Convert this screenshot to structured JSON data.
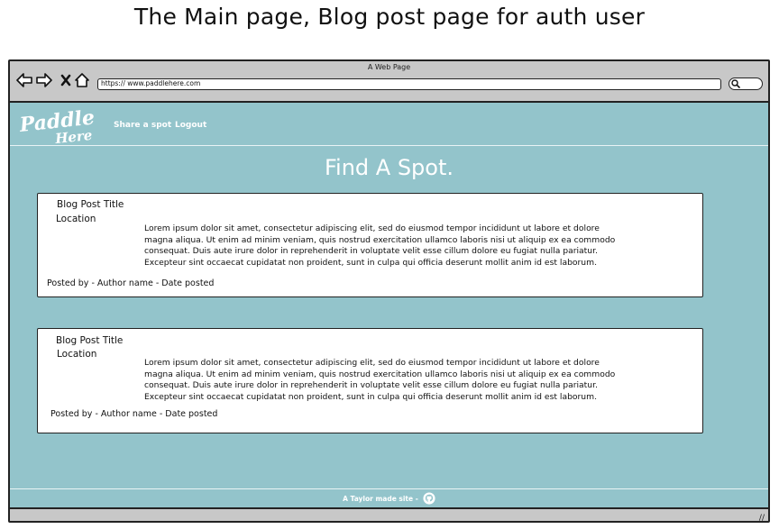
{
  "caption": "The Main page, Blog post page for auth user",
  "browser": {
    "window_title": "A Web Page",
    "url": "https:// www.paddlehere.com",
    "icons": [
      "back-arrow-icon",
      "forward-arrow-icon",
      "close-icon",
      "home-icon",
      "search-icon",
      "resize-grip-icon"
    ]
  },
  "site": {
    "logo_line1": "Paddle",
    "logo_line2": "Here",
    "nav": {
      "share": "Share a spot",
      "logout": "Logout"
    },
    "heading": "Find A Spot.",
    "footer_text": "A Taylor made site -",
    "footer_icon": "github-icon",
    "accent_color": "#93c4cb"
  },
  "posts": [
    {
      "title": "Blog Post Title",
      "location": "Location",
      "body": "Lorem ipsum dolor sit amet, consectetur adipiscing elit, sed do eiusmod tempor incididunt ut labore et dolore magna aliqua. Ut enim ad minim veniam, quis nostrud exercitation ullamco laboris nisi ut aliquip ex ea commodo consequat. Duis aute irure dolor in reprehenderit in voluptate velit esse cillum dolore eu fugiat nulla pariatur. Excepteur sint occaecat cupidatat non proident, sunt in culpa qui officia deserunt mollit anim id est laborum.",
      "meta": "Posted by - Author name - Date posted"
    },
    {
      "title": "Blog Post Title",
      "location": "Location",
      "body": "Lorem ipsum dolor sit amet, consectetur adipiscing elit, sed do eiusmod tempor incididunt ut labore et dolore magna aliqua. Ut enim ad minim veniam, quis nostrud exercitation ullamco laboris nisi ut aliquip ex ea commodo consequat. Duis aute irure dolor in reprehenderit in voluptate velit esse cillum dolore eu fugiat nulla pariatur. Excepteur sint occaecat cupidatat non proident, sunt in culpa qui officia deserunt mollit anim id est laborum.",
      "meta": "Posted by - Author name - Date posted"
    }
  ]
}
